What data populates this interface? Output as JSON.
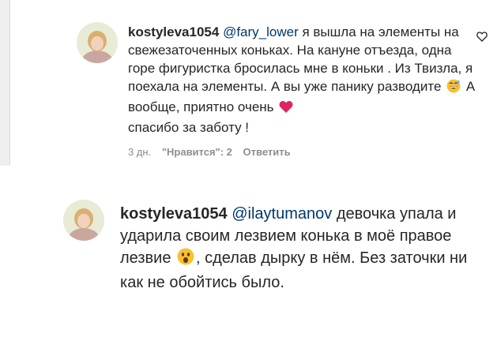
{
  "comment1": {
    "username": "kostyleva1054",
    "mention": "@fary_lower",
    "text_part1": " я вышла на элементы на свежезаточенных коньках. На кануне отъезда, одна горе фигуристка бросилась мне в коньки . Из Твизла, я поехала на элементы. А вы уже панику разводите",
    "text_part2": "  А вообще, приятно очень",
    "text_part3": "спасибо за заботу !",
    "time": "3 дн.",
    "likes": "\"Нравится\": 2",
    "reply": "Ответить",
    "icons": [
      "grinning-sweat-emoji",
      "red-heart-emoji",
      "heart-outline-icon"
    ],
    "colors": {
      "heart": "#e0245e",
      "emoji": "#f7c131"
    }
  },
  "comment2": {
    "username": "kostyleva1054",
    "mention": "@ilaytumanov",
    "text_part1": " девочка упала и ударила своим лезвием конька в моё правое лезвие",
    "text_part2": ", сделав дырку в нём. Без заточки ни как не обойтись было.",
    "icons": [
      "surprised-face-emoji"
    ]
  }
}
